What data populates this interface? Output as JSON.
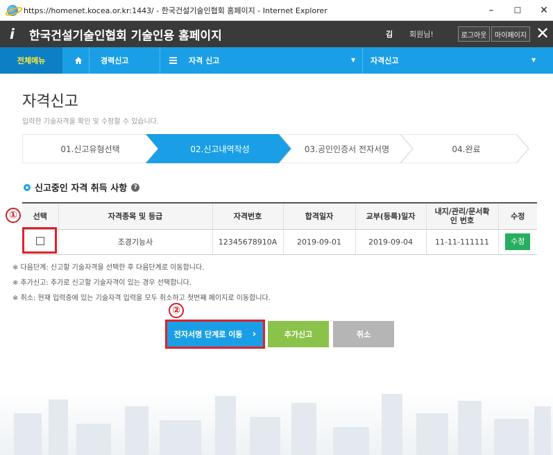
{
  "browser": {
    "title": "https://homenet.kocea.or.kr:1443/ - 한국건설기술인협회 홈페이지 - Internet Explorer",
    "minimize": "–",
    "maximize": "☐",
    "close": "✕"
  },
  "header": {
    "logo": "i",
    "title": "한국건설기술인협회 기술인용 홈페이지",
    "user_name": "김",
    "user_suffix": "회원님!",
    "logout_label": "로그아웃",
    "mypage_label": "마이페이지",
    "close_label": "✕"
  },
  "nav": {
    "all_menu": "전체메뉴",
    "home_icon": "home-icon",
    "item1": "경력신고",
    "menu_icon": "menu-icon",
    "item2": "자격 신고",
    "item3": "자격신고"
  },
  "page": {
    "title": "자격신고",
    "subtitle": "입력한 기술자격을 확인 및 수정할 수 있습니다."
  },
  "steps": [
    {
      "label": "01.신고유형선택",
      "active": false
    },
    {
      "label": "02.신고내역작성",
      "active": true
    },
    {
      "label": "03.공인인증서 전자서명",
      "active": false
    },
    {
      "label": "04.완료",
      "active": false
    }
  ],
  "section": {
    "title": "신고중인 자격 취득 사항",
    "help": "?"
  },
  "table": {
    "headers": [
      "선택",
      "자격종목 및 등급",
      "자격번호",
      "합격일자",
      "교부(등록)일자",
      "내지/관리/문서확인 번호",
      "수정"
    ],
    "rows": [
      {
        "type": "조경기능사",
        "number": "12345678910A",
        "pass_date": "2019-09-01",
        "issue_date": "2019-09-04",
        "doc_number": "11-11-111111",
        "edit_label": "수정"
      }
    ]
  },
  "annotations": [
    "①",
    "②"
  ],
  "notes": [
    "※ 다음단계: 신고할 기술자격을 선택한 후 다음단계로 이동합니다.",
    "※ 추가신고: 추가로 신고할 기술자격이 있는 경우 선택합니다.",
    "※ 취소: 현재 입력중에 있는 기술자격 입력을 모두 취소하고 첫번째 페이지로 이동합니다."
  ],
  "buttons": {
    "next": "전자서명 단계로 이동",
    "next_arrow": "›",
    "add": "추가신고",
    "cancel": "취소"
  },
  "colors": {
    "nav_blue": "#1a9fe6",
    "active_step": "#1a9fe6",
    "edit_green": "#27ae60",
    "add_green": "#8bc34a",
    "cancel_gray": "#b5b5b5",
    "highlight_red": "#e0202a"
  }
}
